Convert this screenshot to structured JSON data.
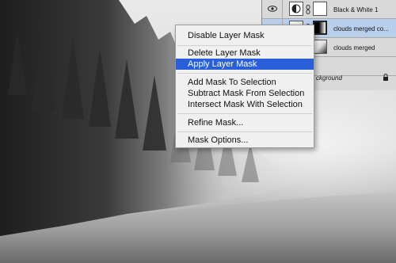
{
  "layers": [
    {
      "name": "Black & White 1",
      "selected": false,
      "mask_link": true
    },
    {
      "name": "clouds merged co...",
      "selected": true,
      "mask_link": true
    },
    {
      "name": "clouds merged",
      "selected": false,
      "mask_link": false
    },
    {
      "name": "ckground",
      "selected": false,
      "mask_link": false,
      "locked": true
    }
  ],
  "context_menu": {
    "items": [
      {
        "label": "Disable Layer Mask",
        "highlighted": false
      },
      {
        "label": "Delete Layer Mask",
        "highlighted": false
      },
      {
        "label": "Apply Layer Mask",
        "highlighted": true
      },
      {
        "label": "Add Mask To Selection",
        "highlighted": false
      },
      {
        "label": "Subtract Mask From Selection",
        "highlighted": false
      },
      {
        "label": "Intersect Mask With Selection",
        "highlighted": false
      },
      {
        "label": "Refine Mask...",
        "highlighted": false
      },
      {
        "label": "Mask Options...",
        "highlighted": false
      }
    ],
    "highlight_color": "#2a5fdc"
  },
  "icons": {
    "visibility": "eye-icon",
    "link": "chain-link-icon",
    "adjustment": "half-circle-adjustment-icon",
    "lock": "lock-icon"
  }
}
